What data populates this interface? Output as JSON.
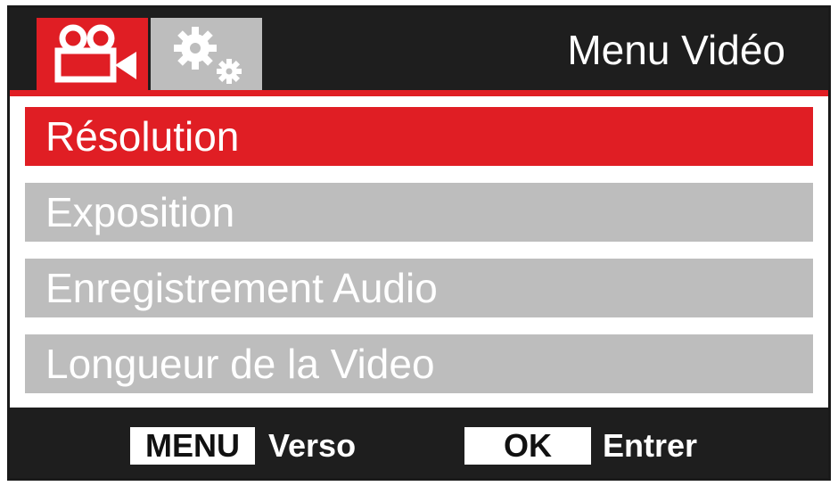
{
  "header": {
    "title": "Menu Vidéo",
    "tabs": [
      {
        "icon": "video-camera-icon",
        "active": true
      },
      {
        "icon": "settings-gears-icon",
        "active": false
      }
    ]
  },
  "menu": {
    "items": [
      {
        "label": "Résolution",
        "selected": true
      },
      {
        "label": "Exposition",
        "selected": false
      },
      {
        "label": "Enregistrement Audio",
        "selected": false
      },
      {
        "label": "Longueur de la Video",
        "selected": false
      }
    ]
  },
  "footer": {
    "menu_key": "MENU",
    "menu_action": "Verso",
    "ok_key": "OK",
    "ok_action": "Entrer"
  },
  "colors": {
    "accent": "#e01e24",
    "bar": "#1e1e1e",
    "inactive": "#bdbdbd"
  }
}
